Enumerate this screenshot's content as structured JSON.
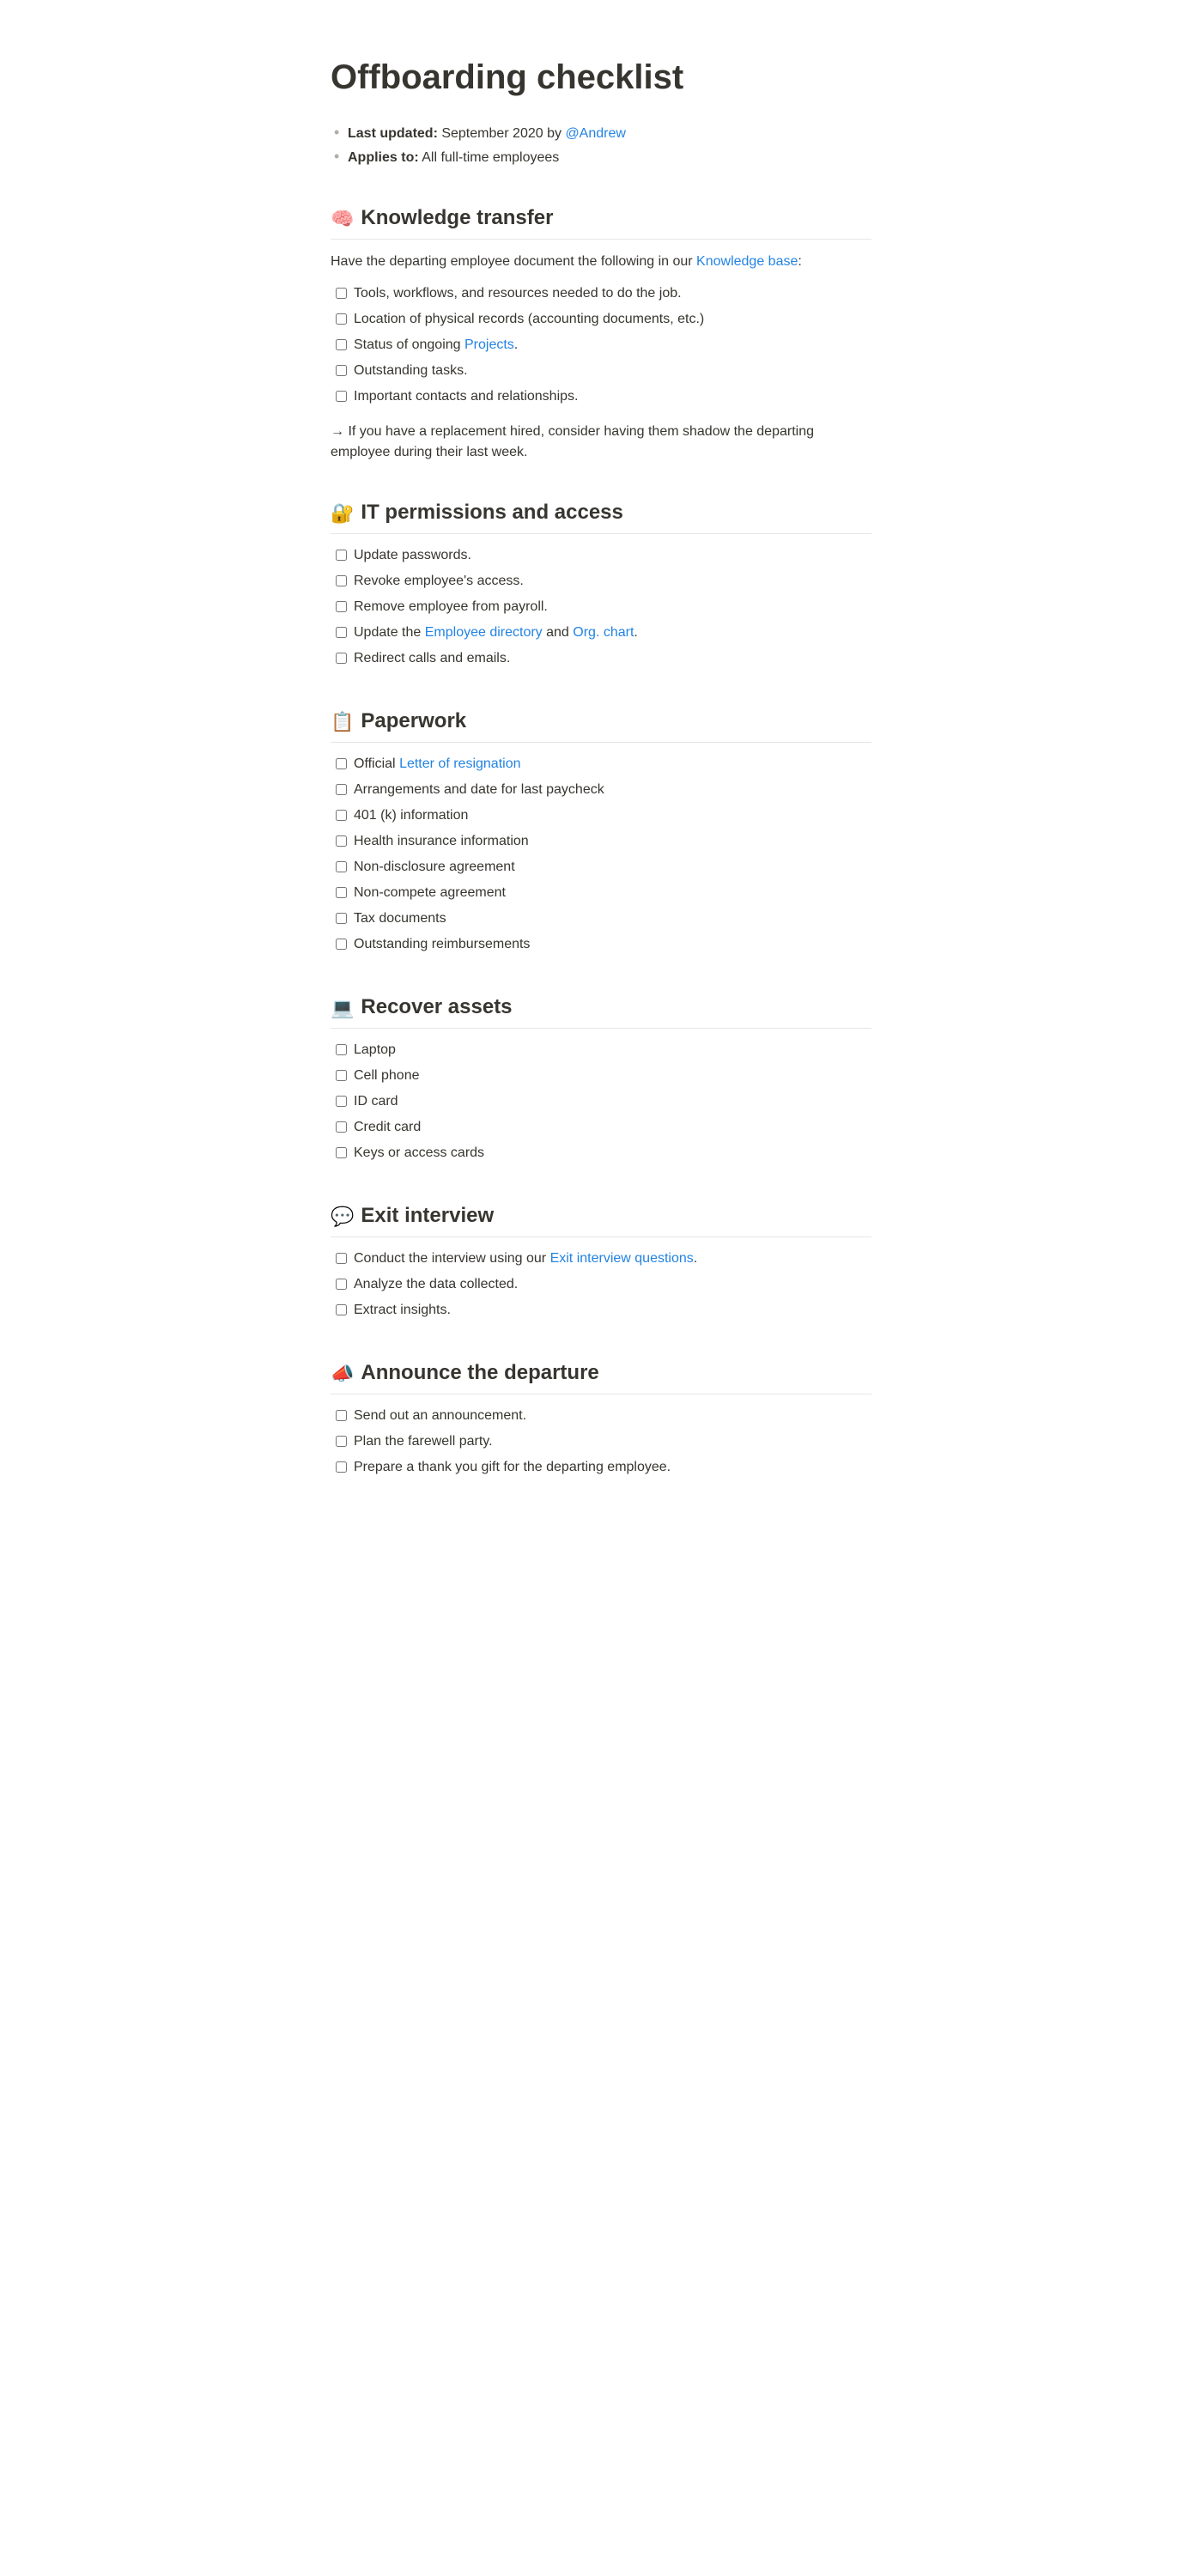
{
  "title": "Offboarding checklist",
  "meta": {
    "updated_label": "Last updated:",
    "updated_value": " September 2020 by ",
    "updated_mention": "@Andrew",
    "applies_label": "Applies to:",
    "applies_value": " All full-time employees"
  },
  "sections": {
    "knowledge": {
      "emoji": "🧠",
      "title": "Knowledge transfer",
      "intro_pre": "Have the departing employee document  the following in our ",
      "intro_link": "Knowledge base",
      "intro_post": ":",
      "items": {
        "i0": "Tools, workflows, and resources needed to do the job.",
        "i1": "Location of physical records (accounting documents, etc.)",
        "i2_pre": "Status of ongoing ",
        "i2_link": "Projects",
        "i2_post": ".",
        "i3": "Outstanding tasks.",
        "i4": "Important contacts and relationships."
      },
      "note": "→ If you have a replacement hired, consider having them shadow the departing employee during their last week."
    },
    "it": {
      "emoji": "🔐",
      "title": "IT permissions and access",
      "items": {
        "i0": "Update passwords.",
        "i1": "Revoke employee's access.",
        "i2": "Remove employee from payroll.",
        "i3_pre": "Update the ",
        "i3_link1": "Employee directory",
        "i3_mid": " and ",
        "i3_link2": "Org. chart",
        "i3_post": ".",
        "i4": "Redirect calls and emails."
      }
    },
    "paperwork": {
      "emoji": "📋",
      "title": "Paperwork",
      "items": {
        "i0_pre": "Official ",
        "i0_link": "Letter of resignation",
        "i1": "Arrangements and date for last paycheck",
        "i2": "401 (k) information",
        "i3": "Health insurance information",
        "i4": "Non-disclosure agreement",
        "i5": "Non-compete agreement",
        "i6": "Tax documents",
        "i7": "Outstanding reimbursements"
      }
    },
    "assets": {
      "emoji": "💻",
      "title": "Recover assets",
      "items": {
        "i0": "Laptop",
        "i1": "Cell phone",
        "i2": "ID card",
        "i3": "Credit card",
        "i4": "Keys or access cards"
      }
    },
    "exit": {
      "emoji": "💬",
      "title": "Exit interview",
      "items": {
        "i0_pre": "Conduct the interview using our ",
        "i0_link": "Exit interview questions",
        "i0_post": ".",
        "i1": "Analyze the data collected.",
        "i2": "Extract insights."
      }
    },
    "announce": {
      "emoji": "📣",
      "title": "Announce the departure",
      "items": {
        "i0": "Send out an announcement.",
        "i1": "Plan the farewell party.",
        "i2": "Prepare a thank you gift for the departing employee."
      }
    }
  }
}
